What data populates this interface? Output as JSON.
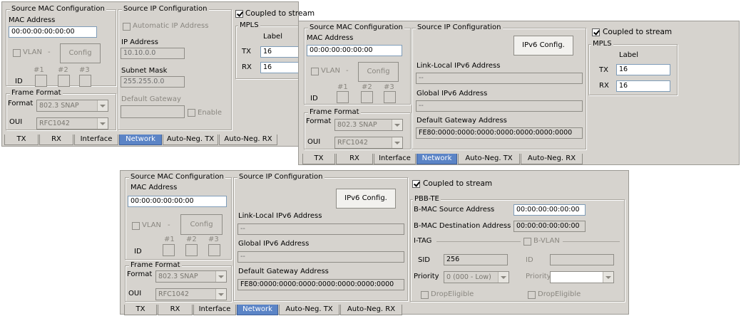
{
  "src_mac": {
    "legend": "Source MAC Configuration",
    "mac_label": "MAC Address",
    "mac_value": "00:00:00:00:00:00",
    "vlan_label": "VLAN",
    "config_label": "Config",
    "id_label": "ID",
    "cols": [
      "#1",
      "#2",
      "#3"
    ]
  },
  "frame": {
    "legend": "Frame Format",
    "format_label": "Format",
    "format_value": "802.3 SNAP",
    "oui_label": "OUI",
    "oui_value": "RFC1042"
  },
  "ipv4": {
    "legend": "Source IP Configuration",
    "auto_label": "Automatic IP Address",
    "ip_label": "IP Address",
    "ip_value": "10.10.0.0",
    "mask_label": "Subnet Mask",
    "mask_value": "255.255.0.0",
    "gw_label": "Default Gateway",
    "enable_label": "Enable"
  },
  "ipv6": {
    "legend": "Source IP Configuration",
    "btn": "IPv6 Config.",
    "ll_label": "Link-Local IPv6 Address",
    "ll_value": "--",
    "global_label": "Global IPv6 Address",
    "global_value": "--",
    "gw_label": "Default Gateway Address",
    "gw_value": "FE80:0000:0000:0000:0000:0000:0000:0000"
  },
  "coupled": "Coupled to stream",
  "mpls": {
    "legend": "MPLS",
    "label": "Label",
    "tx": "TX",
    "rx": "RX",
    "tx_value": "16",
    "rx_value": "16"
  },
  "pbb": {
    "legend": "PBB-TE",
    "bsrc_label": "B-MAC Source Address",
    "bsrc_value": "00:00:00:00:00:00",
    "bdst_label": "B-MAC Destination Address",
    "bdst_value": "00:00:00:00:00:00",
    "itag_label": "I-TAG",
    "bvlan_label": "B-VLAN",
    "sid_label": "SID",
    "sid_value": "256",
    "id_label": "ID",
    "prio_label": "Priority",
    "prio_value": "0 (000 - Low)",
    "prio2_label": "Priority",
    "drop_label": "DropEligible"
  },
  "tabs": [
    "TX",
    "RX",
    "Interface",
    "Network",
    "Auto-Neg. TX",
    "Auto-Neg. RX"
  ]
}
